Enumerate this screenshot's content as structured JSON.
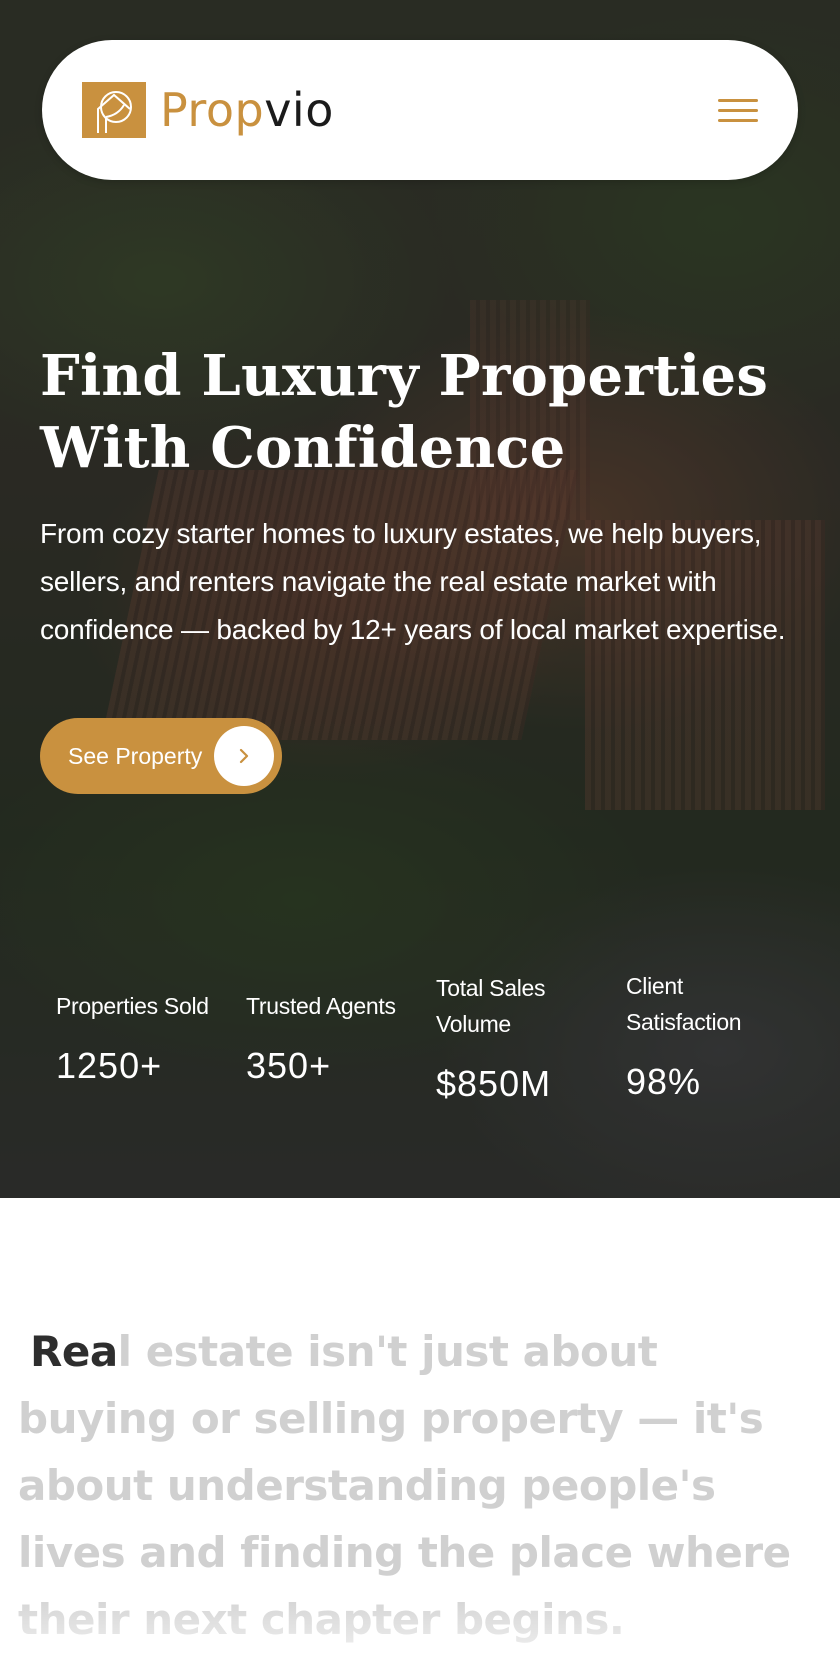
{
  "brand": {
    "name_part1": "Prop",
    "name_part2": "vio",
    "accent_color": "#c9913f",
    "logo_icon": "house-leaf-logo-icon"
  },
  "navbar": {
    "menu_icon": "hamburger-menu-icon"
  },
  "hero": {
    "title_line1": "Find Luxury Properties",
    "title_line2": "With Confidence",
    "subtitle": "From cozy starter homes to luxury estates, we help buyers, sellers, and renters navigate the real estate market with confidence — backed by 12+ years of local market expertise.",
    "cta_label": "See Property",
    "cta_icon": "chevron-right-icon"
  },
  "stats": [
    {
      "label": "Properties Sold",
      "value": "1250+"
    },
    {
      "label": "Trusted Agents",
      "value": "350+"
    },
    {
      "label": "Total Sales Volume",
      "value": "$850M"
    },
    {
      "label": "Client Satisfaction",
      "value": "98%"
    }
  ],
  "quote": {
    "highlighted": "Rea",
    "rest": "l estate isn't just about buying or selling property — it's about understanding people's lives and finding the place where their next chapter begins."
  }
}
